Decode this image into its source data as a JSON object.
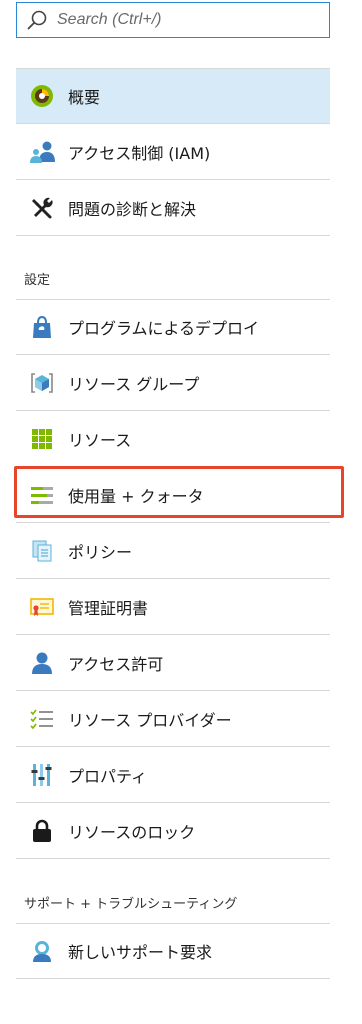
{
  "search": {
    "placeholder": "Search (Ctrl+/)"
  },
  "general_items": [
    {
      "label": "概要",
      "icon": "overview-icon"
    },
    {
      "label": "アクセス制御 (IAM)",
      "icon": "access-control-icon"
    },
    {
      "label": "問題の診断と解決",
      "icon": "diagnose-tools-icon"
    }
  ],
  "settings_header": "設定",
  "settings_items": [
    {
      "label": "プログラムによるデプロイ",
      "icon": "deployment-bag-icon"
    },
    {
      "label": "リソース グループ",
      "icon": "resource-group-icon"
    },
    {
      "label": "リソース",
      "icon": "resources-grid-icon"
    },
    {
      "label": "使用量 + クォータ",
      "icon": "usage-quota-icon"
    },
    {
      "label": "ポリシー",
      "icon": "policy-icon"
    },
    {
      "label": "管理証明書",
      "icon": "certificate-icon"
    },
    {
      "label": "アクセス許可",
      "icon": "user-permission-icon"
    },
    {
      "label": "リソース プロバイダー",
      "icon": "provider-list-icon"
    },
    {
      "label": "プロパティ",
      "icon": "properties-sliders-icon"
    },
    {
      "label": "リソースのロック",
      "icon": "lock-icon"
    }
  ],
  "support_header": "サポート + トラブルシューティング",
  "support_items": [
    {
      "label": "新しいサポート要求",
      "icon": "support-request-icon"
    }
  ],
  "colors": {
    "active_bg": "#d6ebf7",
    "highlight_border": "#e8442a",
    "accent": "#2b88d8"
  }
}
